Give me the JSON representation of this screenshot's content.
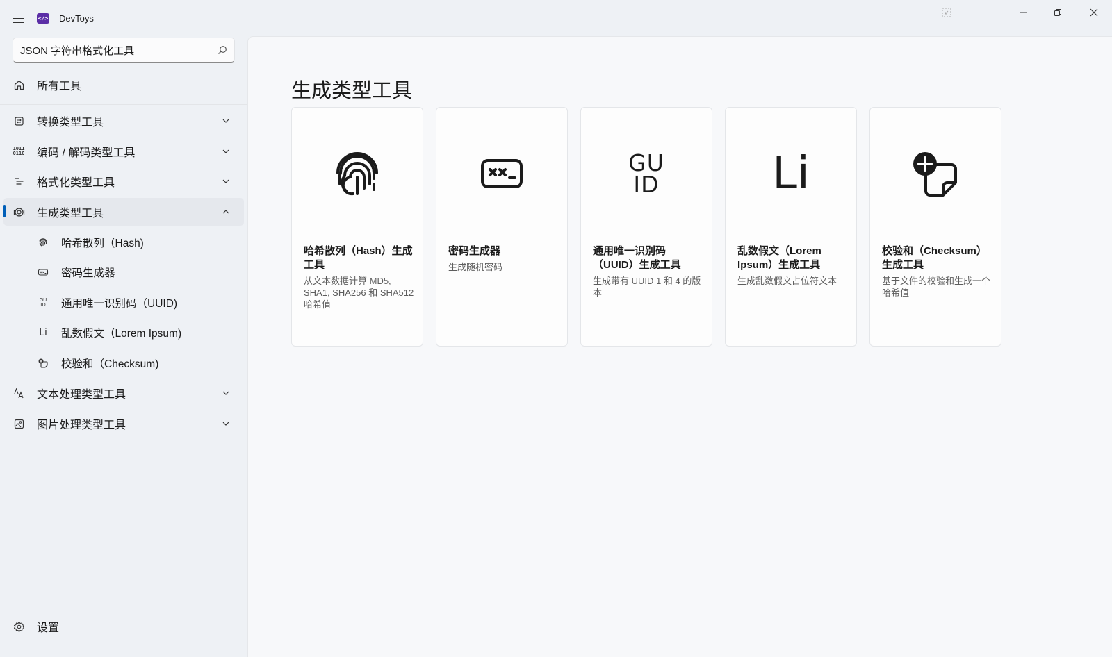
{
  "app": {
    "title": "DevToys",
    "logo_text": "</>",
    "accent_color": "#005fb8",
    "logo_color": "#5b2ea6"
  },
  "search": {
    "value": "JSON 字符串格式化工具",
    "placeholder": ""
  },
  "sidebar": {
    "all_tools": "所有工具",
    "groups": [
      {
        "label": "转换类型工具",
        "icon": "converter-icon"
      },
      {
        "label": "编码 / 解码类型工具",
        "icon": "binary-icon"
      },
      {
        "label": "格式化类型工具",
        "icon": "format-lines-icon"
      },
      {
        "label": "生成类型工具",
        "icon": "generator-icon",
        "expanded": true,
        "selected": true
      },
      {
        "label": "文本处理类型工具",
        "icon": "text-icon"
      },
      {
        "label": "图片处理类型工具",
        "icon": "image-icon"
      }
    ],
    "generator_items": [
      {
        "label": "哈希散列（Hash)",
        "icon": "fingerprint-icon"
      },
      {
        "label": "密码生成器",
        "icon": "password-icon"
      },
      {
        "label": "通用唯一识别码（UUID)",
        "icon": "guid-icon"
      },
      {
        "label": "乱数假文（Lorem Ipsum)",
        "icon": "lorem-icon"
      },
      {
        "label": "校验和（Checksum)",
        "icon": "checksum-icon"
      }
    ],
    "settings": "设置"
  },
  "main": {
    "title": "生成类型工具",
    "cards": [
      {
        "title": "哈希散列（Hash）生成工具",
        "description": "从文本数据计算 MD5, SHA1, SHA256 和 SHA512 哈希值",
        "icon": "fingerprint-icon"
      },
      {
        "title": "密码生成器",
        "description": "生成随机密码",
        "icon": "password-icon"
      },
      {
        "title": "通用唯一识别码（UUID）生成工具",
        "description": "生成带有 UUID 1 和 4 的版本",
        "icon": "guid-icon"
      },
      {
        "title": "乱数假文（Lorem Ipsum）生成工具",
        "description": "生成乱数假文占位符文本",
        "icon": "lorem-icon"
      },
      {
        "title": "校验和（Checksum）生成工具",
        "description": "基于文件的校验和生成一个哈希值",
        "icon": "checksum-icon"
      }
    ]
  },
  "icon_text": {
    "guid_top": "GU",
    "guid_bottom": "ID",
    "lorem": "Li"
  }
}
